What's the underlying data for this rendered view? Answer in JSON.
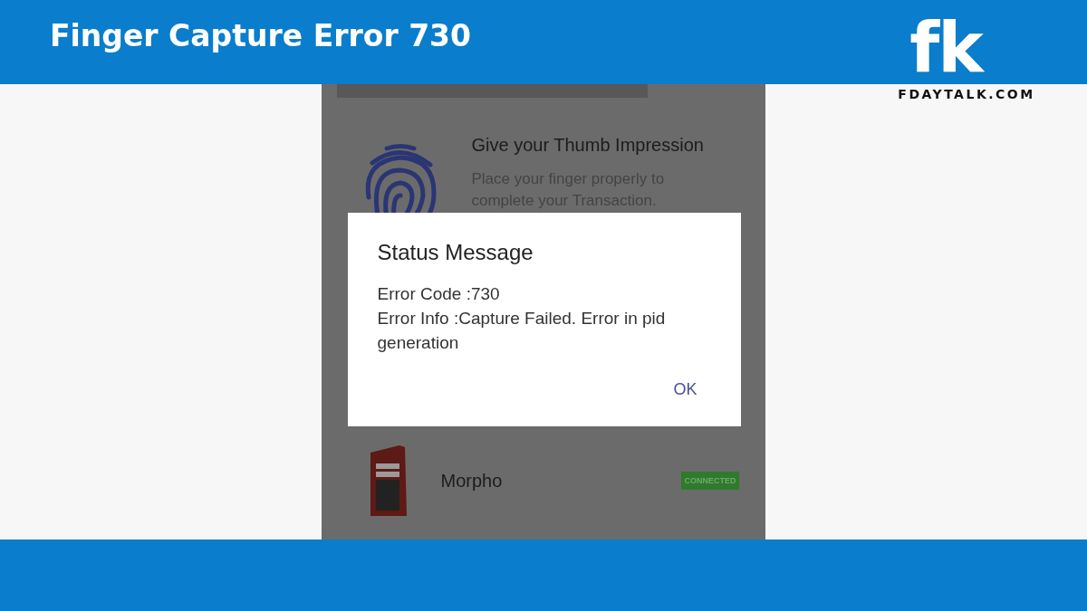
{
  "header": {
    "title": "Finger Capture Error 730"
  },
  "logo": {
    "mark": "fk",
    "site": "FDAYTALK.COM"
  },
  "phone": {
    "prompt": {
      "title": "Give your Thumb Impression",
      "text": "Place your finger properly to complete your Transaction."
    },
    "device": {
      "name": "Morpho",
      "status": "CONNECTED"
    },
    "dialog": {
      "title": "Status Message",
      "lines": [
        "Error Code :730",
        "Error Info :Capture Failed. Error in pid generation"
      ],
      "button": "OK"
    }
  }
}
